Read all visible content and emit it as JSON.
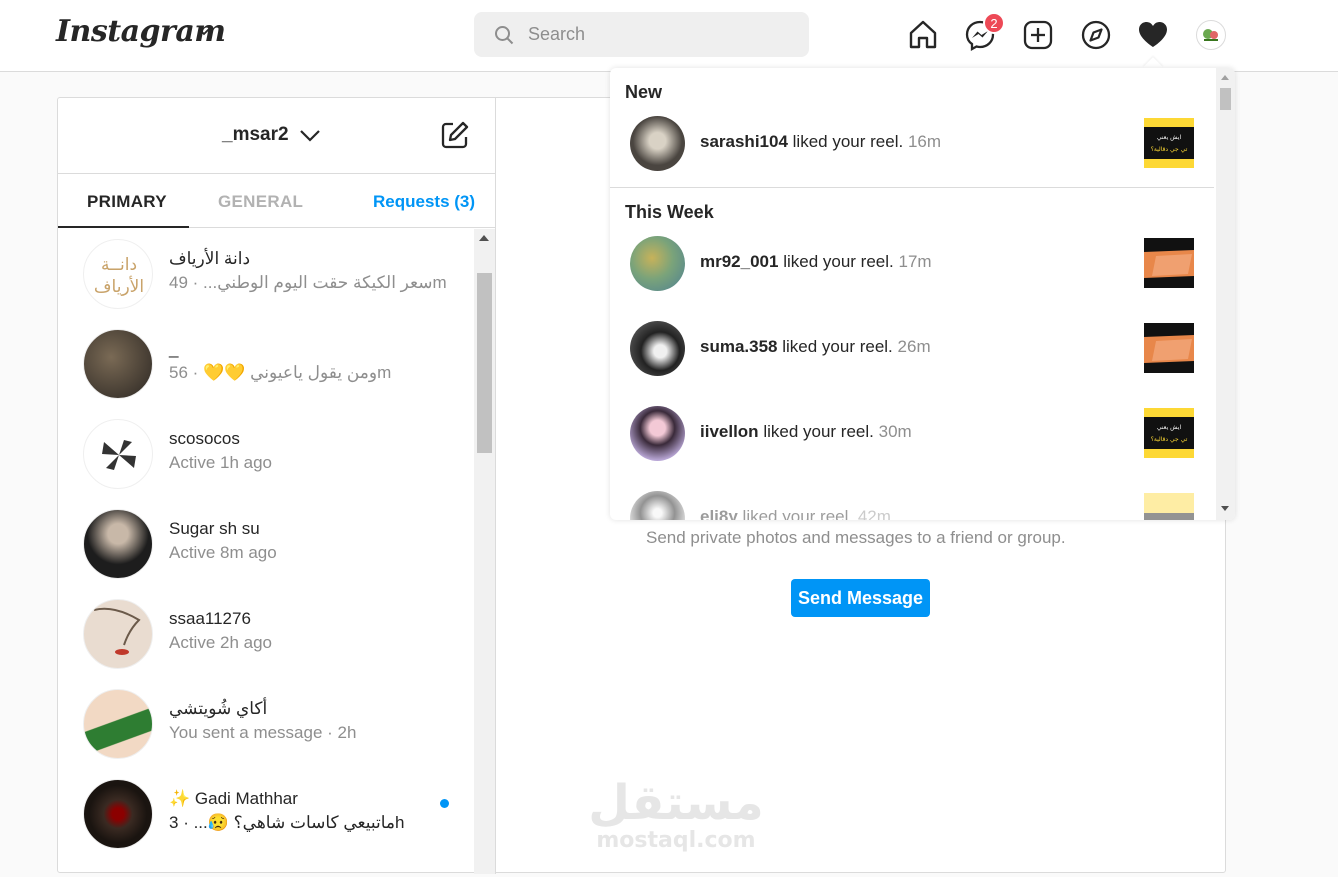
{
  "app": {
    "logo": "Instagram"
  },
  "search": {
    "placeholder": "Search"
  },
  "nav": {
    "messenger_badge": "2"
  },
  "inbox": {
    "account": "_msar2",
    "tabs": {
      "primary": "PRIMARY",
      "general": "GENERAL",
      "requests": "Requests (3)"
    },
    "conversations": [
      {
        "name": "دانة الأرياف",
        "sub": "سعر الكيكة حقت اليوم الوطني... · 49m"
      },
      {
        "name": "_",
        "sub": "ومن يقول ياعيوني 💛💛 · 56m"
      },
      {
        "name": "scosocos",
        "sub": "Active 1h ago"
      },
      {
        "name": "Sugar sh su",
        "sub": "Active 8m ago"
      },
      {
        "name": "ssaa11276",
        "sub": "Active 2h ago"
      },
      {
        "name": "أكاي شُويتشي",
        "sub": "You sent a message · 2h"
      },
      {
        "name": "✨ Gadi Mathhar",
        "sub": "ماتبيعي كاسات شاهي؟ 😥... · 3h"
      }
    ],
    "empty_state": {
      "subtitle": "Send private photos and messages to a friend or group.",
      "button": "Send Message"
    },
    "watermark": {
      "ar": "مستقل",
      "en": "mostaql.com"
    }
  },
  "activity": {
    "sections": {
      "new": "New",
      "this_week": "This Week"
    },
    "items": [
      {
        "user": "sarashi104",
        "action": "liked your reel.",
        "time": "16m"
      },
      {
        "user": "mr92_001",
        "action": "liked your reel.",
        "time": "17m"
      },
      {
        "user": "suma.358",
        "action": "liked your reel.",
        "time": "26m"
      },
      {
        "user": "iivellon",
        "action": "liked your reel.",
        "time": "30m"
      },
      {
        "user": "eli8y",
        "action": "liked your reel.",
        "time": "42m"
      }
    ],
    "thumb_text": {
      "top": "ايش يعني",
      "bottom": "تي جي دقالية؟"
    }
  },
  "colors": {
    "accent": "#0095f6",
    "badge": "#ed4956",
    "thumb_yellow": "#fdd835",
    "thumb_orange": "#e8874a"
  }
}
